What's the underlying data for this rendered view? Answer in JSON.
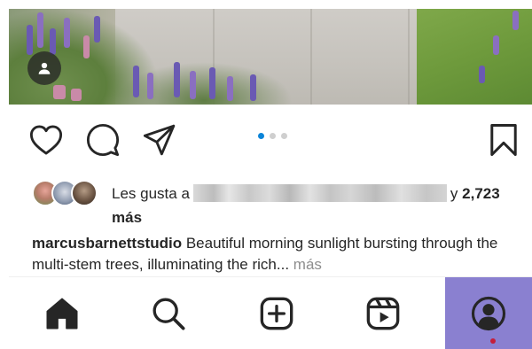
{
  "post": {
    "carousel": {
      "count": 3,
      "active_index": 0
    },
    "likes": {
      "prefix": "Les gusta a",
      "connector": "y",
      "count": "2,723",
      "suffix": "más"
    },
    "caption": {
      "username": "marcusbarnettstudio",
      "text": "Beautiful morning sunlight bursting through the multi-stem trees, illuminating the rich...",
      "more_label": "más"
    }
  },
  "icons": {
    "like": "heart-icon",
    "comment": "comment-icon",
    "share": "send-icon",
    "save": "bookmark-icon",
    "tagged": "person-icon"
  },
  "tabs": [
    "home",
    "search",
    "create",
    "reels",
    "profile"
  ],
  "colors": {
    "carousel_active": "#0a84d8",
    "profile_tab_highlight": "#8a80d0",
    "notification_dot": "#c41e3a",
    "muted_text": "#8e8e8e"
  }
}
